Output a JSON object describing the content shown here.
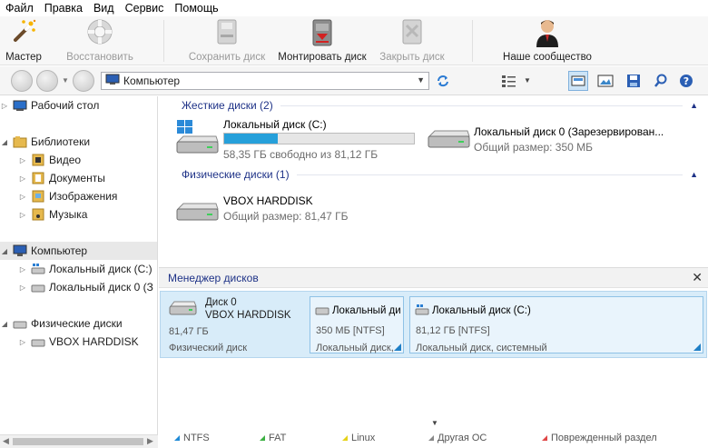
{
  "menu": [
    "Файл",
    "Правка",
    "Вид",
    "Сервис",
    "Помощь"
  ],
  "toolbar": {
    "master": "Мастер",
    "restore": "Восстановить",
    "save_disk": "Сохранить диск",
    "mount_disk": "Монтировать диск",
    "close_disk": "Закрыть диск",
    "community": "Наше сообщество"
  },
  "address": {
    "value": "Компьютер"
  },
  "tree": {
    "desktop": "Рабочий стол",
    "libraries": "Библиотеки",
    "video": "Видео",
    "documents": "Документы",
    "images": "Изображения",
    "music": "Музыка",
    "computer": "Компьютер",
    "local_c": "Локальный диск (C:)",
    "local_0": "Локальный диск 0 (З",
    "physical": "Физические диски",
    "vbox": "VBOX HARDDISK"
  },
  "groups": {
    "hard": "Жесткие диски (2)",
    "physical": "Физические диски (1)"
  },
  "drives": {
    "c": {
      "name": "Локальный диск (C:)",
      "free": "58,35 ГБ свободно из 81,12 ГБ",
      "used_fraction": 0.28
    },
    "reserved": {
      "name": "Локальный диск 0 (Зарезервирован...",
      "size": "Общий размер: 350 МБ"
    },
    "vbox": {
      "name": "VBOX HARDDISK",
      "size": "Общий размер: 81,47 ГБ"
    }
  },
  "disk_manager": {
    "title": "Менеджер дисков",
    "disk": {
      "line1": "Диск 0",
      "line2": "VBOX HARDDISK",
      "size": "81,47 ГБ",
      "type": "Физический диск"
    },
    "p1": {
      "name": "Локальный ди",
      "size": "350 МБ [NTFS]",
      "desc": "Локальный диск,"
    },
    "p2": {
      "name": "Локальный диск (C:)",
      "size": "81,12 ГБ [NTFS]",
      "desc": "Локальный диск, системный"
    }
  },
  "legend": [
    {
      "label": "NTFS",
      "color": "#1f8ad6"
    },
    {
      "label": "FAT",
      "color": "#3cb043"
    },
    {
      "label": "Linux",
      "color": "#e6d21a"
    },
    {
      "label": "Другая ОС",
      "color": "#888888"
    },
    {
      "label": "Поврежденный раздел",
      "color": "#e04848"
    }
  ]
}
